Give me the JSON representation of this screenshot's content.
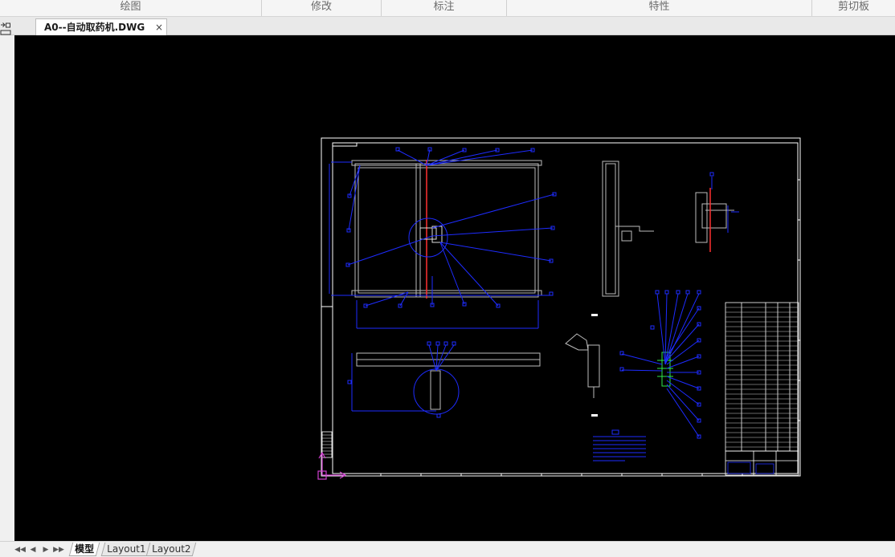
{
  "ribbon": {
    "groups": [
      {
        "label": "绘图"
      },
      {
        "label": "修改"
      },
      {
        "label": "标注"
      },
      {
        "label": "特性"
      },
      {
        "label": "剪切板"
      }
    ]
  },
  "document_tab": {
    "title": "A0--自动取药机.DWG",
    "close_symbol": "×"
  },
  "layout_tabs": [
    {
      "label": "模型",
      "active": true
    },
    {
      "label": "Layout1",
      "active": false
    },
    {
      "label": "Layout2",
      "active": false
    }
  ],
  "navigation": {
    "first": "◀◀",
    "prev": "◀",
    "next": "▶",
    "last": "▶▶"
  },
  "colors": {
    "canvas_background": "#000000",
    "drawing_white": "#ffffff",
    "annotation_blue": "#1e2cff",
    "section_red": "#ff3030",
    "detail_green": "#2ee84a",
    "ucs_magenta": "#d040d0"
  },
  "icons": [
    "ucs-icon",
    "close-icon",
    "first-tab-icon",
    "prev-tab-icon",
    "next-tab-icon",
    "last-tab-icon",
    "side-tool-icon"
  ]
}
